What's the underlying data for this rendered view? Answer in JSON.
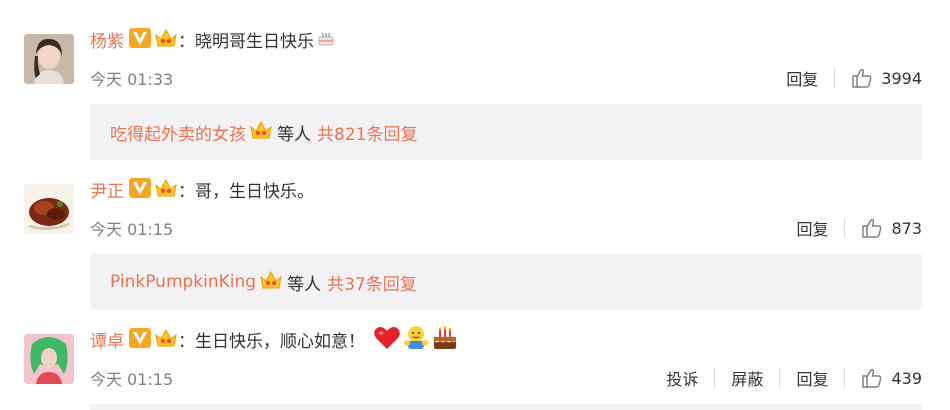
{
  "comments": [
    {
      "username": "杨紫",
      "separator": "：",
      "text": "晓明哥生日快乐",
      "time": "今天 01:33",
      "actions": {
        "reply": "回复"
      },
      "likes": "3994",
      "replies": {
        "preview_user": "吃得起外卖的女孩",
        "etc": "等人",
        "total": "共821条回复"
      }
    },
    {
      "username": "尹正",
      "separator": "：",
      "text": "哥，生日快乐。",
      "time": "今天 01:15",
      "actions": {
        "reply": "回复"
      },
      "likes": "873",
      "replies": {
        "preview_user": "PinkPumpkinKing",
        "etc": "等人",
        "total": "共37条回复"
      }
    },
    {
      "username": "谭卓",
      "separator": "：",
      "text": "生日快乐，顺心如意！",
      "time": "今天 01:15",
      "actions": {
        "report": "投诉",
        "block": "屏蔽",
        "reply": "回复"
      },
      "likes": "439"
    }
  ],
  "colors": {
    "accent": "#eb7350",
    "text": "#333333",
    "muted": "#808080",
    "reply_bg": "#f2f2f5"
  },
  "icons": [
    "verified-v-icon",
    "crown-member-icon",
    "thumbs-up-icon",
    "cake-emoji",
    "heart-emoji",
    "hug-emoji"
  ]
}
